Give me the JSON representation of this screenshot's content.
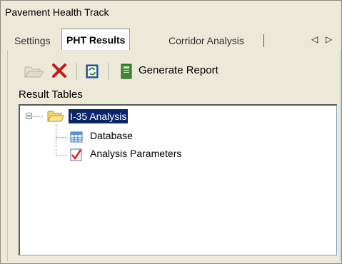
{
  "window": {
    "title": "Pavement Health Track"
  },
  "tabs": [
    {
      "label": "Settings",
      "active": false
    },
    {
      "label": "PHT Results",
      "active": true
    },
    {
      "label": "Corridor Analysis",
      "active": false
    }
  ],
  "tab_nav": {
    "prev_icon": "arrow-left-icon",
    "next_icon": "arrow-right-icon"
  },
  "toolbar": {
    "open_icon": "folder-open-icon",
    "delete_icon": "delete-x-icon",
    "refresh_icon": "refresh-icon",
    "report_icon": "report-book-icon",
    "generate_report_label": "Generate Report"
  },
  "results": {
    "section_label": "Result Tables",
    "root": {
      "label": "I-35 Analysis",
      "icon": "folder-icon",
      "expanded": true,
      "selected": true
    },
    "children": [
      {
        "label": "Database",
        "icon": "table-grid-icon"
      },
      {
        "label": "Analysis Parameters",
        "icon": "checklist-icon"
      }
    ]
  },
  "colors": {
    "selection_bg": "#0a246a",
    "window_bg": "#ece9d8",
    "delete_red": "#c81818"
  }
}
